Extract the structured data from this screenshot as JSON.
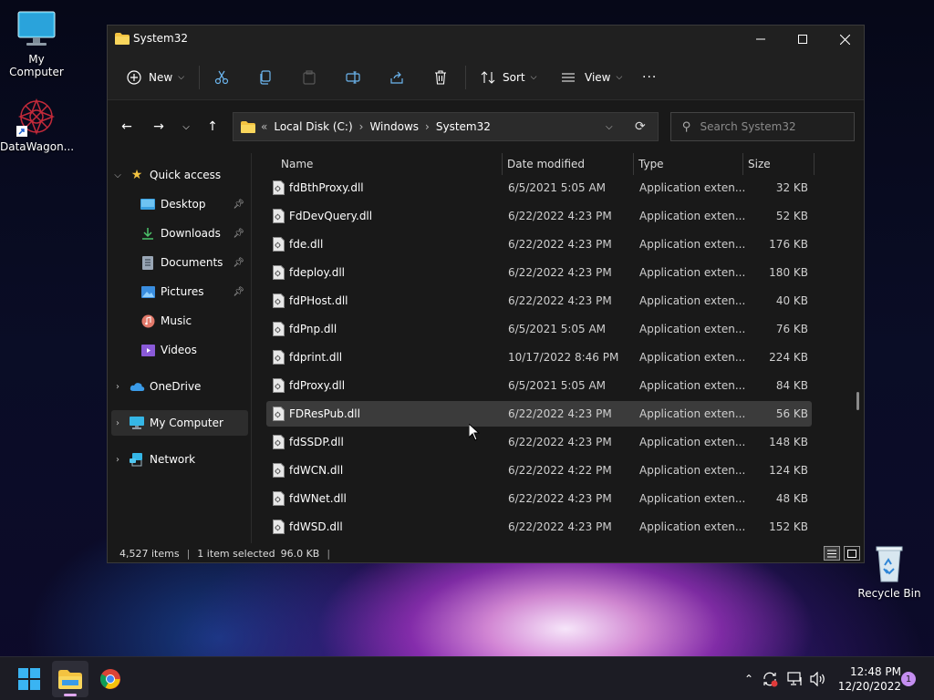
{
  "desktop": {
    "icons": [
      {
        "label": "My Computer"
      },
      {
        "label": "DataWagon..."
      },
      {
        "label": "Recycle Bin"
      }
    ]
  },
  "window": {
    "title": "System32",
    "toolbar": {
      "new_label": "New",
      "sort_label": "Sort",
      "view_label": "View",
      "more_label": "···"
    },
    "breadcrumb": {
      "overflow": "«",
      "items": [
        "Local Disk (C:)",
        "Windows",
        "System32"
      ],
      "separator": "›"
    },
    "search": {
      "placeholder": "Search System32"
    }
  },
  "navpane": {
    "items": [
      {
        "label": "Quick access"
      },
      {
        "label": "Desktop"
      },
      {
        "label": "Downloads"
      },
      {
        "label": "Documents"
      },
      {
        "label": "Pictures"
      },
      {
        "label": "Music"
      },
      {
        "label": "Videos"
      },
      {
        "label": "OneDrive"
      },
      {
        "label": "My Computer"
      },
      {
        "label": "Network"
      }
    ]
  },
  "columns": {
    "name": "Name",
    "date": "Date modified",
    "type": "Type",
    "size": "Size"
  },
  "files": [
    {
      "name": "fdBthProxy.dll",
      "date": "6/5/2021 5:05 AM",
      "type": "Application exten...",
      "size": "32 KB"
    },
    {
      "name": "FdDevQuery.dll",
      "date": "6/22/2022 4:23 PM",
      "type": "Application exten...",
      "size": "52 KB"
    },
    {
      "name": "fde.dll",
      "date": "6/22/2022 4:23 PM",
      "type": "Application exten...",
      "size": "176 KB"
    },
    {
      "name": "fdeploy.dll",
      "date": "6/22/2022 4:23 PM",
      "type": "Application exten...",
      "size": "180 KB"
    },
    {
      "name": "fdPHost.dll",
      "date": "6/22/2022 4:23 PM",
      "type": "Application exten...",
      "size": "40 KB"
    },
    {
      "name": "fdPnp.dll",
      "date": "6/5/2021 5:05 AM",
      "type": "Application exten...",
      "size": "76 KB"
    },
    {
      "name": "fdprint.dll",
      "date": "10/17/2022 8:46 PM",
      "type": "Application exten...",
      "size": "224 KB"
    },
    {
      "name": "fdProxy.dll",
      "date": "6/5/2021 5:05 AM",
      "type": "Application exten...",
      "size": "84 KB"
    },
    {
      "name": "FDResPub.dll",
      "date": "6/22/2022 4:23 PM",
      "type": "Application exten...",
      "size": "56 KB"
    },
    {
      "name": "fdSSDP.dll",
      "date": "6/22/2022 4:23 PM",
      "type": "Application exten...",
      "size": "148 KB"
    },
    {
      "name": "fdWCN.dll",
      "date": "6/22/2022 4:22 PM",
      "type": "Application exten...",
      "size": "124 KB"
    },
    {
      "name": "fdWNet.dll",
      "date": "6/22/2022 4:23 PM",
      "type": "Application exten...",
      "size": "48 KB"
    },
    {
      "name": "fdWSD.dll",
      "date": "6/22/2022 4:23 PM",
      "type": "Application exten...",
      "size": "152 KB"
    }
  ],
  "status": {
    "count": "4,527 items",
    "selected": "1 item selected",
    "size": "96.0 KB"
  },
  "taskbar": {
    "time": "12:48 PM",
    "date": "12/20/2022",
    "notifications": "1"
  },
  "colors": {
    "accent": "#0078d4",
    "folder": "#f3c341",
    "selection": "#3b3b3b"
  }
}
